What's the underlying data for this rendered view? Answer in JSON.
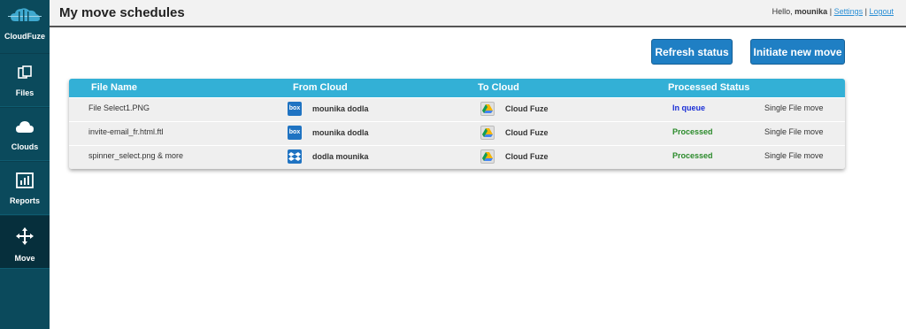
{
  "app": {
    "name": "CloudFuze"
  },
  "sidebar": {
    "items": [
      {
        "label": "Files",
        "icon": "files-icon"
      },
      {
        "label": "Clouds",
        "icon": "cloud-icon"
      },
      {
        "label": "Reports",
        "icon": "reports-icon"
      },
      {
        "label": "Move",
        "icon": "move-icon",
        "active": true
      }
    ]
  },
  "header": {
    "title": "My move schedules",
    "greeting": "Hello,",
    "username": "mounika",
    "separator": "|",
    "settings_label": "Settings",
    "logout_label": "Logout"
  },
  "actions": {
    "refresh_label": "Refresh status",
    "initiate_label": "Initiate new move"
  },
  "table": {
    "columns": [
      "File Name",
      "From Cloud",
      "To Cloud",
      "Processed Status"
    ],
    "rows": [
      {
        "file": "File Select1.PNG",
        "from_icon": "box",
        "from": "mounika dodla",
        "to_icon": "google-drive",
        "to": "Cloud Fuze",
        "status": "In queue",
        "type": "Single File move"
      },
      {
        "file": "invite-email_fr.html.ftl",
        "from_icon": "box",
        "from": "mounika dodla",
        "to_icon": "google-drive",
        "to": "Cloud Fuze",
        "status": "Processed",
        "type": "Single File move"
      },
      {
        "file": "spinner_select.png & more",
        "from_icon": "dropbox",
        "from": "dodla mounika",
        "to_icon": "google-drive",
        "to": "Cloud Fuze",
        "status": "Processed",
        "type": "Single File move"
      }
    ]
  },
  "icons": {
    "box_text": "box"
  },
  "colors": {
    "sidebar": "#0b4a5c",
    "header_row": "#33b0d6",
    "button": "#1f7fc4",
    "status_in_queue": "#1a2fd6",
    "status_processed": "#2a8a2a"
  }
}
